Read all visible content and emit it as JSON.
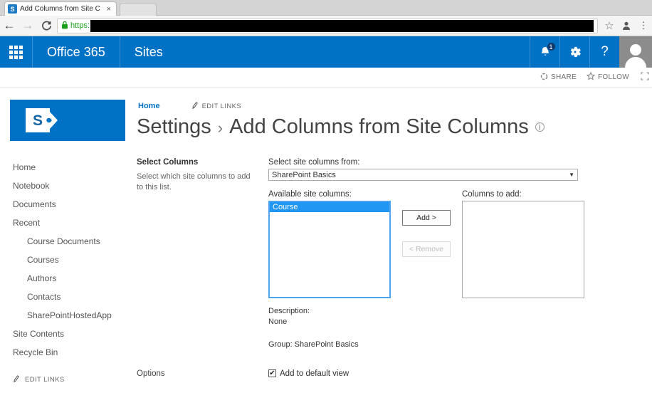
{
  "browser": {
    "tab": {
      "title": "Add Columns from Site C",
      "favicon_label": "S",
      "close_label": "×"
    },
    "nav": {
      "back": "←",
      "forward": "→",
      "reload": "C"
    },
    "address": {
      "lock_icon": "\u0001",
      "scheme": "https:",
      "redacted": true
    },
    "toolbar_icons": {
      "bookmark": "☆",
      "profile": "☺",
      "menu": "⋮"
    }
  },
  "suitebar": {
    "brand": "Office 365",
    "site": "Sites",
    "notifications_badge": "1",
    "icons": {
      "waffle": "app-launcher-icon",
      "bell": "notifications-icon",
      "gear": "settings-icon",
      "help": "?"
    }
  },
  "commandbar": {
    "share": "SHARE",
    "follow": "FOLLOW",
    "focus_tooltip": "FOCUS ON CONTENT"
  },
  "site": {
    "logo_letter": "S",
    "breadcrumb_home": "Home",
    "edit_links": "EDIT LINKS",
    "title_prefix": "Settings",
    "title_separator": "›",
    "title_main": "Add Columns from Site Columns",
    "title_info": "ⓘ"
  },
  "sidebar": {
    "items": [
      {
        "label": "Home",
        "child": false
      },
      {
        "label": "Notebook",
        "child": false
      },
      {
        "label": "Documents",
        "child": false
      },
      {
        "label": "Recent",
        "child": false
      },
      {
        "label": "Course Documents",
        "child": true
      },
      {
        "label": "Courses",
        "child": true
      },
      {
        "label": "Authors",
        "child": true
      },
      {
        "label": "Contacts",
        "child": true
      },
      {
        "label": "SharePointHostedApp",
        "child": true
      },
      {
        "label": "Site Contents",
        "child": false
      },
      {
        "label": "Recycle Bin",
        "child": false
      }
    ],
    "edit_links": "EDIT LINKS"
  },
  "form": {
    "select_columns": {
      "heading": "Select Columns",
      "description": "Select which site columns to add to this list."
    },
    "source_label": "Select site columns from:",
    "source_value": "SharePoint Basics",
    "source_caret": "▼",
    "available_label": "Available site columns:",
    "available_options": [
      "Course"
    ],
    "add_button": "Add >",
    "remove_button": "< Remove",
    "columns_to_add_label": "Columns to add:",
    "columns_to_add_options": [],
    "description_label": "Description:",
    "description_value": "None",
    "group_text": "Group: SharePoint Basics",
    "options": {
      "heading": "Options",
      "checkbox_label": "Add to default view",
      "checkbox_checked": true,
      "check_glyph": "✔"
    }
  },
  "colors": {
    "sharepoint_blue": "#0072c6",
    "selection_blue": "#2196f3",
    "link_blue": "#0072c6"
  }
}
